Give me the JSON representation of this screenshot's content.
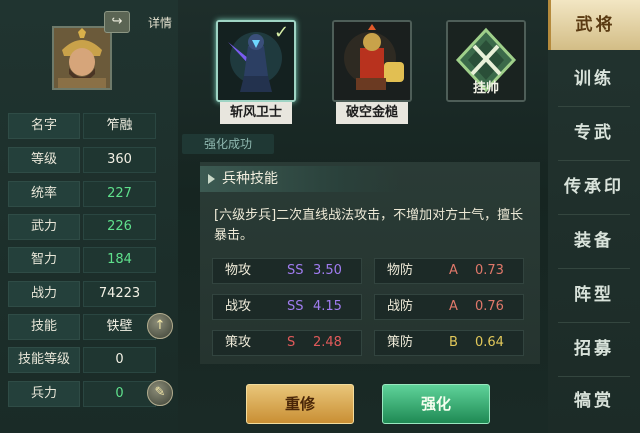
{
  "hero": {
    "detail_label": "详情",
    "stats": [
      {
        "label": "名字",
        "value": "笮融"
      },
      {
        "label": "等级",
        "value": "360"
      },
      {
        "label": "统率",
        "value": "227"
      },
      {
        "label": "武力",
        "value": "226"
      },
      {
        "label": "智力",
        "value": "184"
      },
      {
        "label": "战力",
        "value": "74223"
      },
      {
        "label": "技能",
        "value": "铁壁"
      },
      {
        "label": "技能等级",
        "value": "0"
      },
      {
        "label": "兵力",
        "value": "0"
      }
    ]
  },
  "units": [
    {
      "name": "斩风卫士",
      "selected": true
    },
    {
      "name": "破空金槌",
      "selected": false
    },
    {
      "name": "挂帅",
      "selected": false
    }
  ],
  "success_tag": "强化成功",
  "skill": {
    "title": "兵种技能",
    "description": "[六级步兵]二次直线战法攻击，不增加对方士气，擅长暴击。",
    "attributes": [
      {
        "label": "物攻",
        "grade": "SS",
        "value": "3.50",
        "grade_color": "#a07cf0"
      },
      {
        "label": "物防",
        "grade": "A",
        "value": "0.73",
        "grade_color": "#e0786a"
      },
      {
        "label": "战攻",
        "grade": "SS",
        "value": "4.15",
        "grade_color": "#a07cf0"
      },
      {
        "label": "战防",
        "grade": "A",
        "value": "0.76",
        "grade_color": "#e0786a"
      },
      {
        "label": "策攻",
        "grade": "S",
        "value": "2.48",
        "grade_color": "#e05a5a"
      },
      {
        "label": "策防",
        "grade": "B",
        "value": "0.64",
        "grade_color": "#e2c85a"
      }
    ]
  },
  "buttons": {
    "repair": "重修",
    "enhance": "强化"
  },
  "tabs": [
    "武将",
    "训练",
    "专武",
    "传承印",
    "装备",
    "阵型",
    "招募",
    "犒赏"
  ],
  "active_tab": "武将",
  "colors": {
    "green_stat": "#5fe08c",
    "accent_gold": "#d3bd86",
    "enhance_green": "#1f8a54"
  }
}
